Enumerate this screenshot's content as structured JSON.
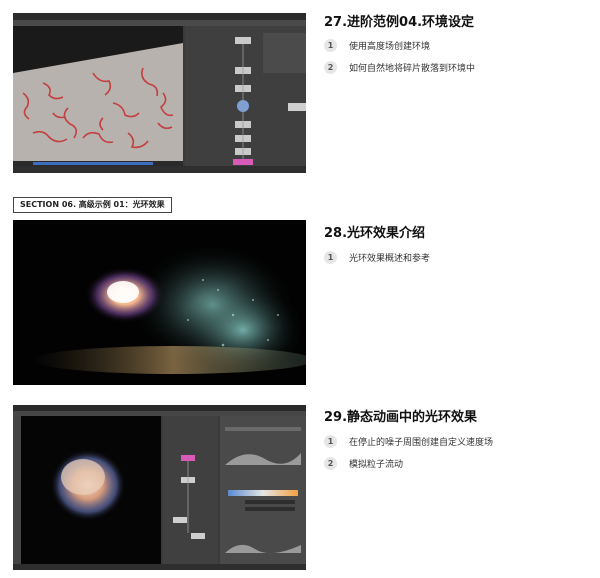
{
  "lessons": [
    {
      "title": "27.进阶范例04.环境设定",
      "items": [
        {
          "num": "1",
          "text": "使用高度场创建环境"
        },
        {
          "num": "2",
          "text": "如何自然地将碎片散落到环境中"
        }
      ]
    },
    {
      "title": "28.光环效果介绍",
      "items": [
        {
          "num": "1",
          "text": "光环效果概述和参考"
        }
      ]
    },
    {
      "title": "29.静态动画中的光环效果",
      "items": [
        {
          "num": "1",
          "text": "在停止的噪子周围创建自定义速度场"
        },
        {
          "num": "2",
          "text": "模拟粒子流动"
        }
      ]
    }
  ],
  "section": {
    "label": "SECTION 06. 高级示例 01：光环效果"
  }
}
